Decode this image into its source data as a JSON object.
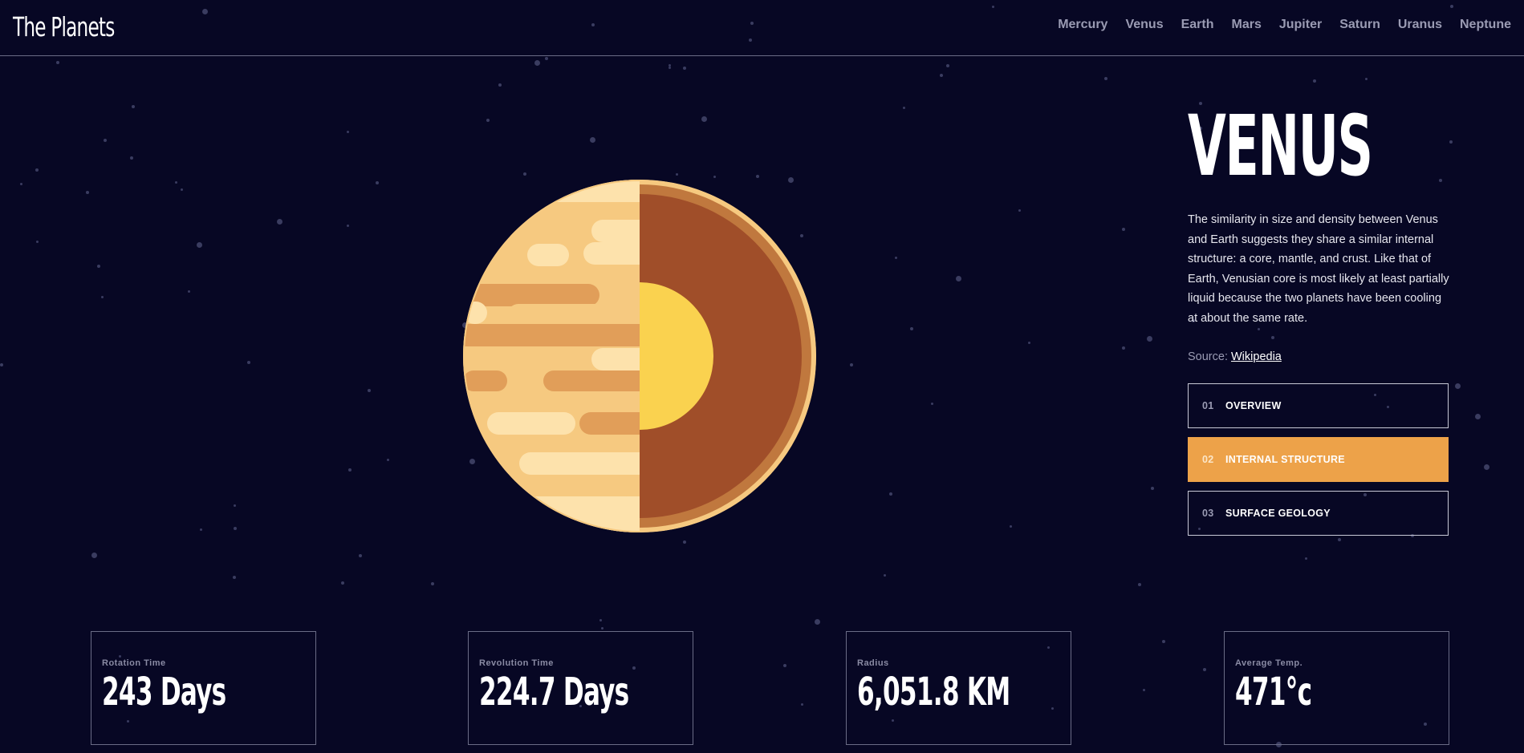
{
  "app": {
    "brand": "The Planets"
  },
  "nav": {
    "items": [
      "Mercury",
      "Venus",
      "Earth",
      "Mars",
      "Jupiter",
      "Saturn",
      "Uranus",
      "Neptune"
    ]
  },
  "planet": {
    "name": "VENUS",
    "description": "The similarity in size and density between Venus and Earth suggests they share a similar internal structure: a core, mantle, and crust. Like that of Earth, Venusian core is most likely at least partially liquid because the two planets have been cooling at about the same rate.",
    "source_prefix": "Source: ",
    "source_link": "Wikipedia",
    "image_icon": "venus-internal-structure-icon"
  },
  "tabs": [
    {
      "number": "01",
      "label": "OVERVIEW",
      "active": false
    },
    {
      "number": "02",
      "label": "INTERNAL STRUCTURE",
      "active": true
    },
    {
      "number": "03",
      "label": "SURFACE GEOLOGY",
      "active": false
    }
  ],
  "stats": [
    {
      "label": "Rotation Time",
      "value": "243 Days"
    },
    {
      "label": "Revolution Time",
      "value": "224.7 Days"
    },
    {
      "label": "Radius",
      "value": "6,051.8 KM"
    },
    {
      "label": "Average Temp.",
      "value": "471°c"
    }
  ],
  "colors": {
    "background": "#070724",
    "accent": "#EDA249",
    "muted_text": "#9a9bb3",
    "border": "#6a6c86"
  }
}
